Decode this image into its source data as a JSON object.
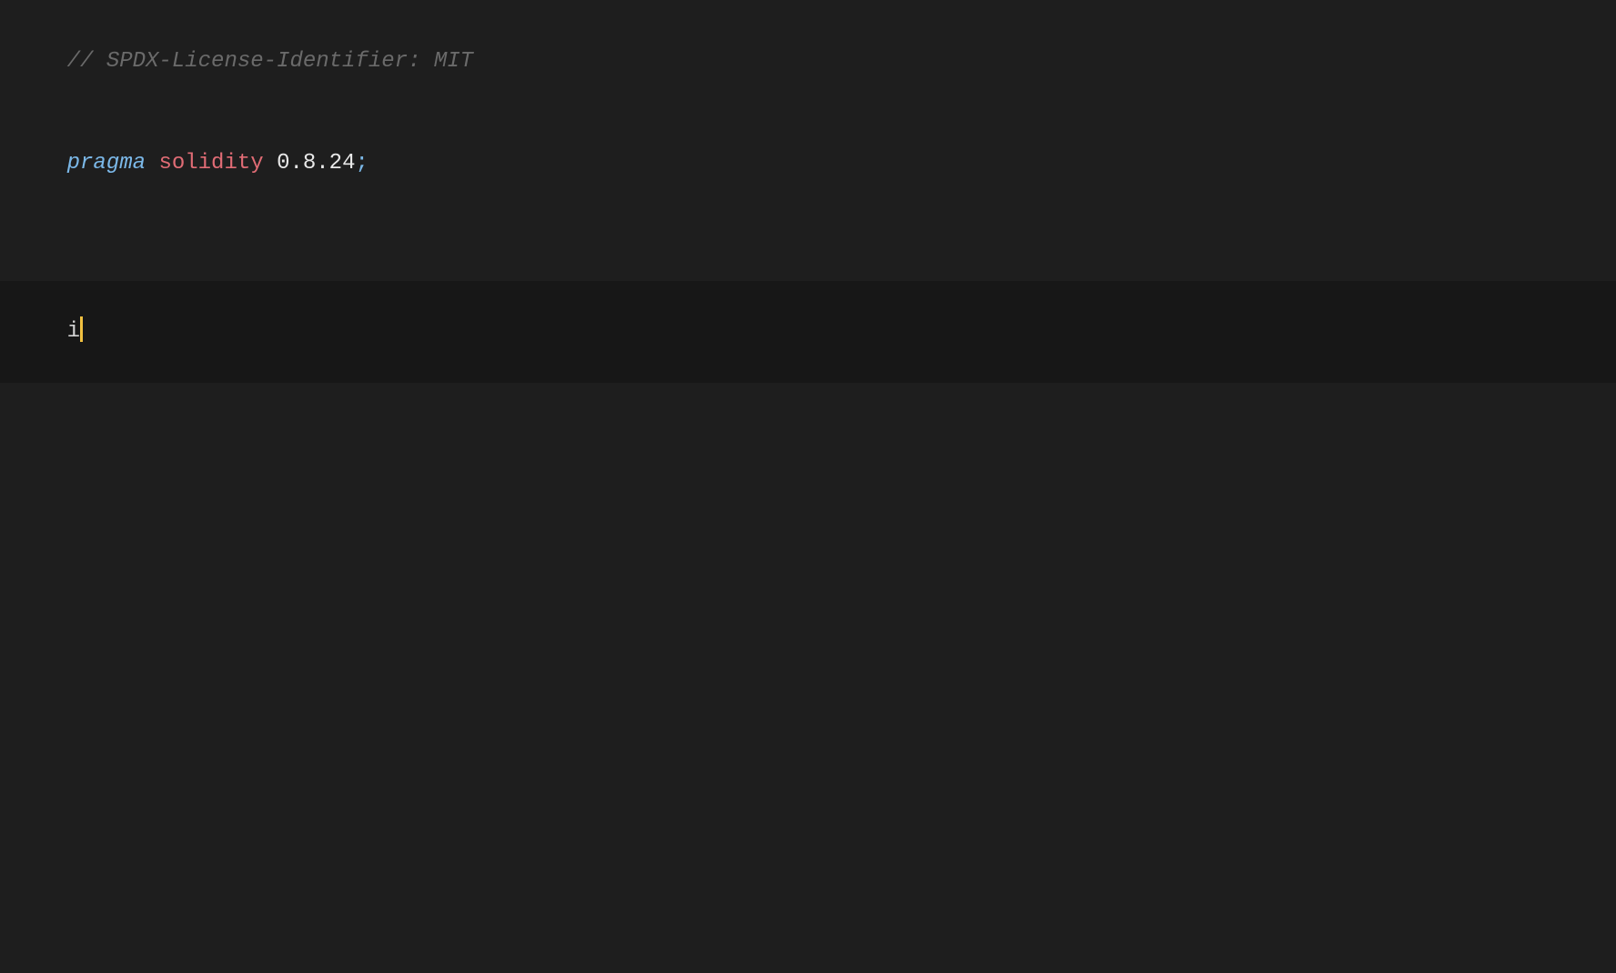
{
  "editor": {
    "lines": {
      "comment": "// SPDX-License-Identifier: MIT",
      "pragma_keyword": "pragma",
      "solidity_keyword": "solidity",
      "version": "0.8.24",
      "semicolon": ";",
      "typing": "i"
    }
  }
}
